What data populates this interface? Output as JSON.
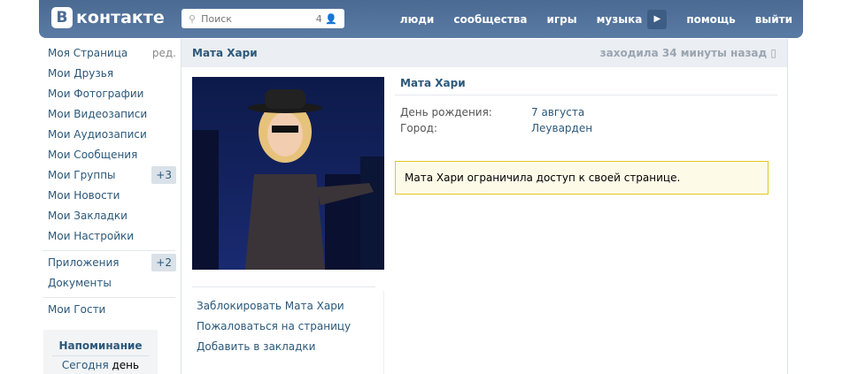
{
  "header": {
    "logo_letter": "В",
    "logo_text": "контакте",
    "search_placeholder": "Поиск",
    "search_count": "4",
    "nav": [
      "люди",
      "сообщества",
      "игры",
      "музыка",
      "помощь",
      "выйти"
    ]
  },
  "sidebar": {
    "edit": "ред.",
    "items": [
      {
        "label": "Моя Страница"
      },
      {
        "label": "Мои Друзья"
      },
      {
        "label": "Мои Фотографии"
      },
      {
        "label": "Мои Видеозаписи"
      },
      {
        "label": "Мои Аудиозаписи"
      },
      {
        "label": "Мои Сообщения"
      },
      {
        "label": "Мои Группы",
        "badge": "+3"
      },
      {
        "label": "Мои Новости"
      },
      {
        "label": "Мои Закладки"
      },
      {
        "label": "Мои Настройки"
      }
    ],
    "apps": {
      "label": "Приложения",
      "badge": "+2"
    },
    "docs": "Документы",
    "guests": "Мои Гости",
    "reminder": {
      "title": "Напоминание",
      "today": "Сегодня",
      "rest": "день"
    }
  },
  "profile": {
    "name": "Мата Хари",
    "status": "заходила 34 минуты назад",
    "fields": [
      {
        "label": "День рождения:",
        "value": "7 августа"
      },
      {
        "label": "Город:",
        "value": "Леуварден"
      }
    ],
    "notice": "Мата Хари ограничила доступ к своей странице.",
    "actions": [
      "Заблокировать Мата Хари",
      "Пожаловаться на страницу",
      "Добавить в закладки"
    ]
  }
}
